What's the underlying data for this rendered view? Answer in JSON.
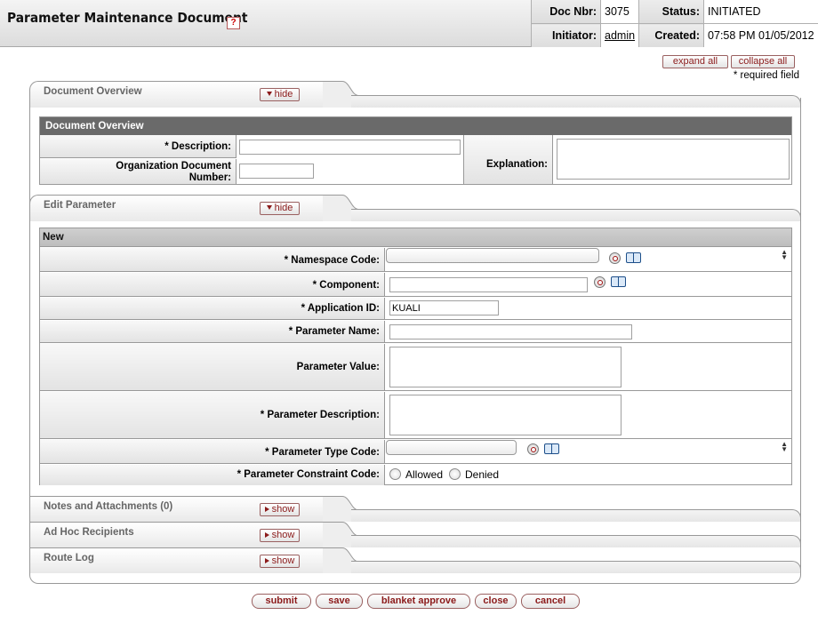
{
  "header": {
    "title": "Parameter Maintenance Document",
    "help_glyph": "?",
    "doc_nbr_label": "Doc Nbr:",
    "doc_nbr": "3075",
    "status_label": "Status:",
    "status": "INITIATED",
    "initiator_label": "Initiator:",
    "initiator": "admin",
    "created_label": "Created:",
    "created": "07:58 PM 01/05/2012"
  },
  "controls": {
    "expand_all": "expand all",
    "collapse_all": "collapse all",
    "required_note": "* required field"
  },
  "tabs": {
    "document_overview": {
      "label": "Document Overview",
      "toggle": "hide"
    },
    "edit_parameter": {
      "label": "Edit Parameter",
      "toggle": "hide"
    },
    "notes": {
      "label": "Notes and Attachments (0)",
      "toggle": "show"
    },
    "adhoc": {
      "label": "Ad Hoc Recipients",
      "toggle": "show"
    },
    "route_log": {
      "label": "Route Log",
      "toggle": "show"
    }
  },
  "overview": {
    "heading": "Document Overview",
    "description_label": "* Description:",
    "description_value": "",
    "org_doc_label_1": "Organization Document",
    "org_doc_label_2": "Number:",
    "org_doc_value": "",
    "explanation_label": "Explanation:",
    "explanation_value": ""
  },
  "edit": {
    "heading": "New",
    "fields": {
      "namespace_code": {
        "label": "* Namespace Code:",
        "value": ""
      },
      "component": {
        "label": "* Component:",
        "value": ""
      },
      "application_id": {
        "label": "* Application ID:",
        "value": "KUALI"
      },
      "parameter_name": {
        "label": "* Parameter Name:",
        "value": ""
      },
      "parameter_value": {
        "label": "Parameter Value:",
        "value": ""
      },
      "parameter_description": {
        "label": "* Parameter Description:",
        "value": ""
      },
      "parameter_type_code": {
        "label": "* Parameter Type Code:",
        "value": ""
      },
      "parameter_constraint_code": {
        "label": "* Parameter Constraint Code:",
        "options": [
          "Allowed",
          "Denied"
        ],
        "selected": null
      }
    }
  },
  "actions": {
    "submit": "submit",
    "save": "save",
    "blanket_approve": "blanket approve",
    "close": "close",
    "cancel": "cancel"
  },
  "icons": {
    "lookup": "lookup-icon",
    "inquiry": "book-icon",
    "help": "help-icon"
  }
}
